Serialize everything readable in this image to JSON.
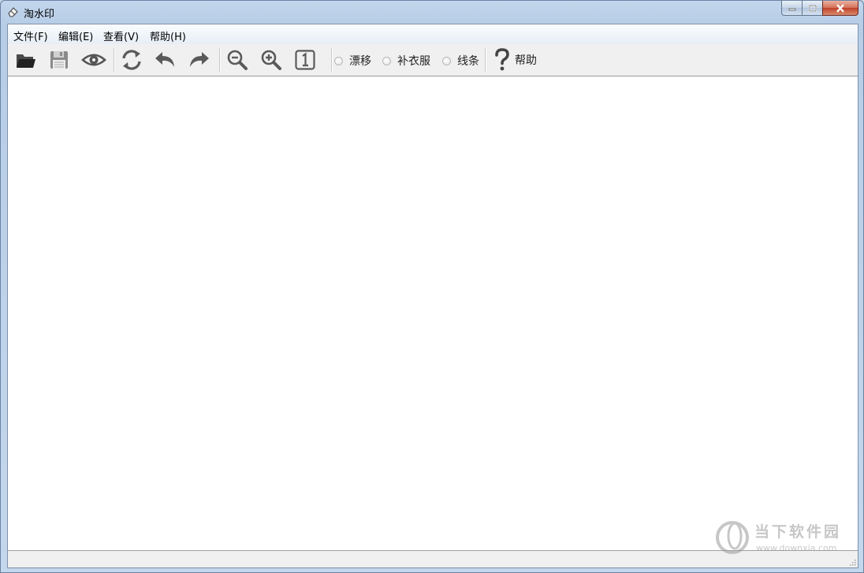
{
  "window": {
    "title": "淘水印"
  },
  "menu": [
    {
      "label": "文件(F)"
    },
    {
      "label": "编辑(E)"
    },
    {
      "label": "查看(V)"
    },
    {
      "label": "帮助(H)"
    }
  ],
  "toolbar": {
    "icons": [
      "open-folder-icon",
      "save-disk-icon",
      "preview-eye-icon",
      "refresh-icon",
      "undo-icon",
      "redo-icon",
      "zoom-out-icon",
      "zoom-in-icon",
      "actual-size-icon"
    ],
    "modes": [
      {
        "label": "漂移",
        "selected": false
      },
      {
        "label": "补衣服",
        "selected": false
      },
      {
        "label": "线条",
        "selected": false
      }
    ],
    "help_label": "帮助"
  },
  "watermark": {
    "name": "当下软件园",
    "url": "www.downxia.com"
  },
  "colors": {
    "titlebar": "#b9cfe7",
    "close_button": "#c8452d",
    "icon_gray": "#555555"
  }
}
